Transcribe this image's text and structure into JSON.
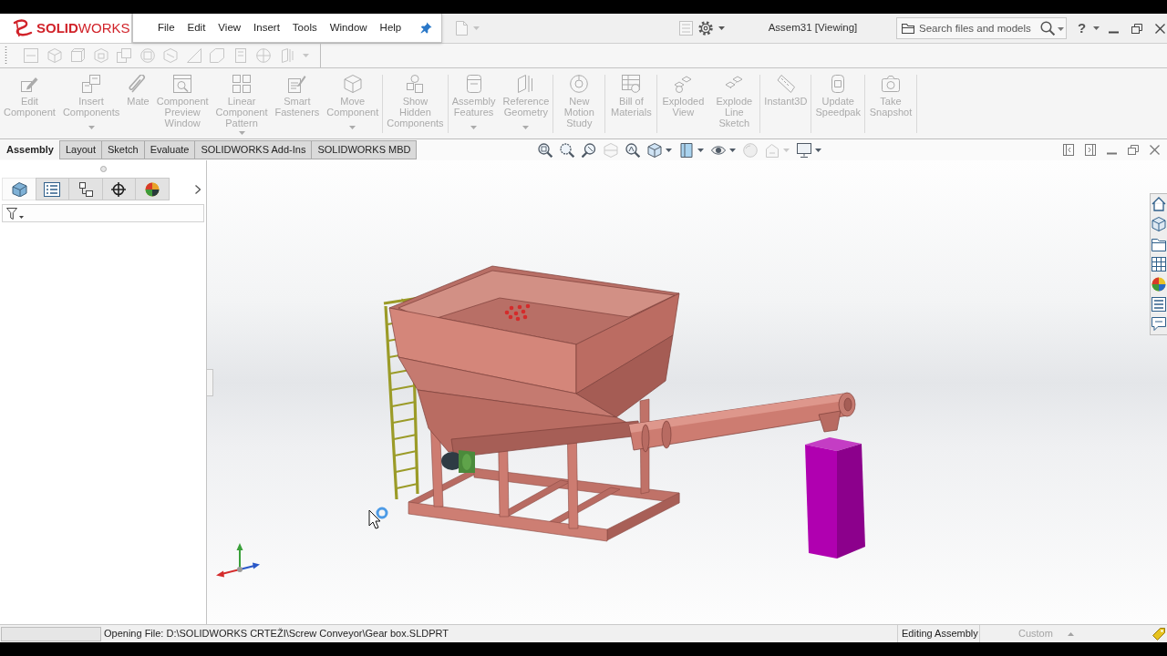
{
  "logo": {
    "text": "**SOLID**WORKS"
  },
  "menu": {
    "items": [
      "File",
      "Edit",
      "View",
      "Insert",
      "Tools",
      "Window",
      "Help"
    ],
    "pinned": true
  },
  "quick_access": [
    {
      "disabled": true,
      "dropdown": true
    },
    {
      "disabled": true,
      "dropdown": false
    },
    {
      "disabled": false,
      "dropdown": true
    }
  ],
  "window": {
    "title": "Assem31 [Viewing]"
  },
  "search": {
    "placeholder": "Search files and models"
  },
  "help": {
    "label": "?"
  },
  "standard_toolbar": {
    "disabled": true
  },
  "ribbon": {
    "groups": [
      {
        "buttons": [
          {
            "label": "Edit Component",
            "dropdown": false,
            "disabled": true
          },
          {
            "label": "Insert Components",
            "dropdown": true,
            "disabled": true
          },
          {
            "label": "Mate",
            "dropdown": false,
            "disabled": true
          },
          {
            "label": "Component Preview Window",
            "dropdown": false,
            "disabled": true
          },
          {
            "label": "Linear Component Pattern",
            "dropdown": true,
            "disabled": true
          },
          {
            "label": "Smart Fasteners",
            "dropdown": false,
            "disabled": true
          },
          {
            "label": "Move Component",
            "dropdown": true,
            "disabled": true
          }
        ]
      },
      {
        "buttons": [
          {
            "label": "Show Hidden Components",
            "dropdown": false,
            "disabled": true
          }
        ]
      },
      {
        "buttons": [
          {
            "label": "Assembly Features",
            "dropdown": true,
            "disabled": true
          },
          {
            "label": "Reference Geometry",
            "dropdown": true,
            "disabled": true
          }
        ]
      },
      {
        "buttons": [
          {
            "label": "New Motion Study",
            "dropdown": false,
            "disabled": true
          }
        ]
      },
      {
        "buttons": [
          {
            "label": "Bill of Materials",
            "dropdown": false,
            "disabled": true
          }
        ]
      },
      {
        "buttons": [
          {
            "label": "Exploded View",
            "dropdown": false,
            "disabled": true
          },
          {
            "label": "Explode Line Sketch",
            "dropdown": false,
            "disabled": true
          }
        ]
      },
      {
        "buttons": [
          {
            "label": "Instant3D",
            "dropdown": false,
            "disabled": true
          }
        ]
      },
      {
        "buttons": [
          {
            "label": "Update Speedpak",
            "dropdown": false,
            "disabled": true
          }
        ]
      },
      {
        "buttons": [
          {
            "label": "Take Snapshot",
            "dropdown": false,
            "disabled": true
          }
        ]
      }
    ]
  },
  "command_tabs": [
    {
      "label": "Assembly",
      "selected": true
    },
    {
      "label": "Layout",
      "selected": false
    },
    {
      "label": "Sketch",
      "selected": false
    },
    {
      "label": "Evaluate",
      "selected": false
    },
    {
      "label": "SOLIDWORKS Add-Ins",
      "selected": false
    },
    {
      "label": "SOLIDWORKS MBD",
      "selected": false
    }
  ],
  "heads_up_toolbar": [
    {
      "disabled": false,
      "dropdown": false
    },
    {
      "disabled": false,
      "dropdown": false
    },
    {
      "disabled": false,
      "dropdown": false
    },
    {
      "disabled": true,
      "dropdown": false
    },
    {
      "disabled": false,
      "dropdown": false
    },
    {
      "disabled": false,
      "dropdown": true
    },
    {
      "disabled": false,
      "dropdown": true
    },
    {
      "disabled": false,
      "dropdown": true
    },
    {
      "disabled": true,
      "dropdown": false
    },
    {
      "disabled": true,
      "dropdown": true
    },
    {
      "disabled": false,
      "dropdown": true
    }
  ],
  "panel_tabs": [
    {
      "selected": true
    },
    {
      "selected": false
    },
    {
      "selected": false
    },
    {
      "selected": false
    },
    {
      "selected": false
    }
  ],
  "status_bar": {
    "message": "Opening File: D:\\SOLIDWORKS CRTEŽI\\Screw Conveyor\\Gear box.SLDPRT",
    "mode": "Editing Assembly",
    "units": {
      "label": "Custom",
      "disabled": true
    }
  }
}
